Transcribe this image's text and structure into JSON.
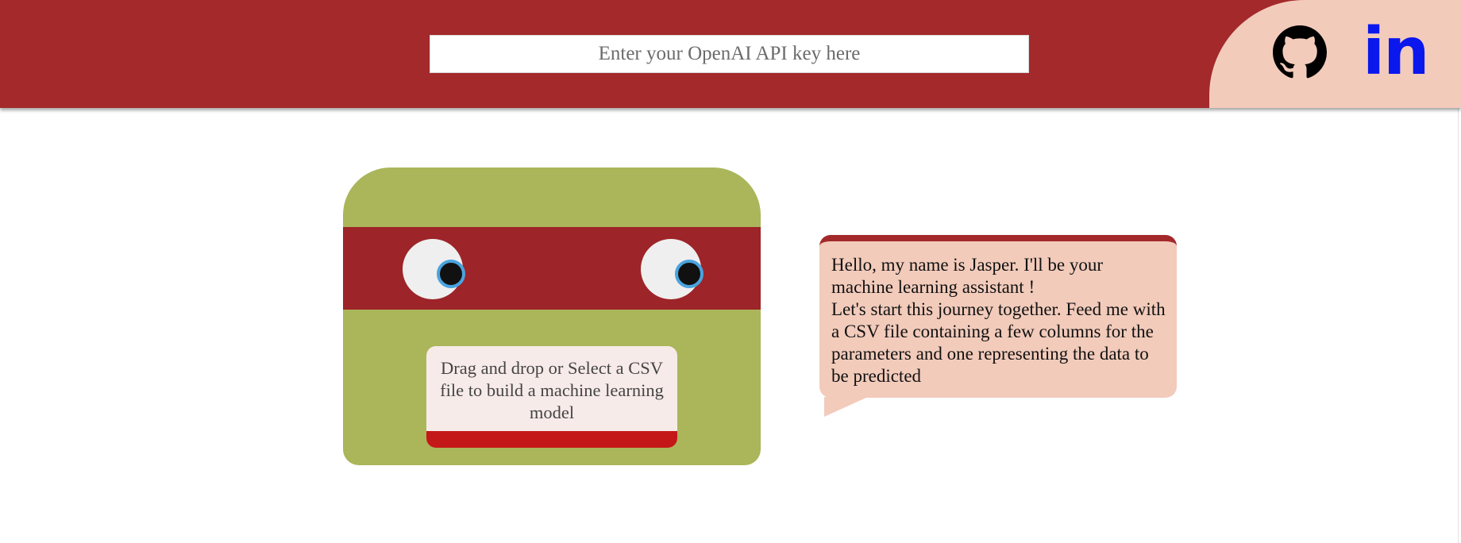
{
  "header": {
    "api_key_placeholder": "Enter your OpenAI API key here",
    "api_key_value": "",
    "social": {
      "github_icon": "github-octocat-icon",
      "linkedin_label": "in",
      "linkedin_icon": "linkedin-icon"
    }
  },
  "robot": {
    "upload_text": "Drag and drop or Select a CSV file to build a machine learning model"
  },
  "assistant": {
    "message": "Hello, my name is Jasper. I'll be your machine learning assistant !\nLet's start this journey together. Feed me with a CSV file containing a few columns for the parameters and one representing the data to be predicted"
  },
  "colors": {
    "header_bg": "#a3292a",
    "social_bg": "#f2cbbb",
    "robot_body": "#abb55a",
    "robot_mask": "#9d2428",
    "mouth": "#c41818",
    "linkedin_blue": "#0a18ee"
  }
}
